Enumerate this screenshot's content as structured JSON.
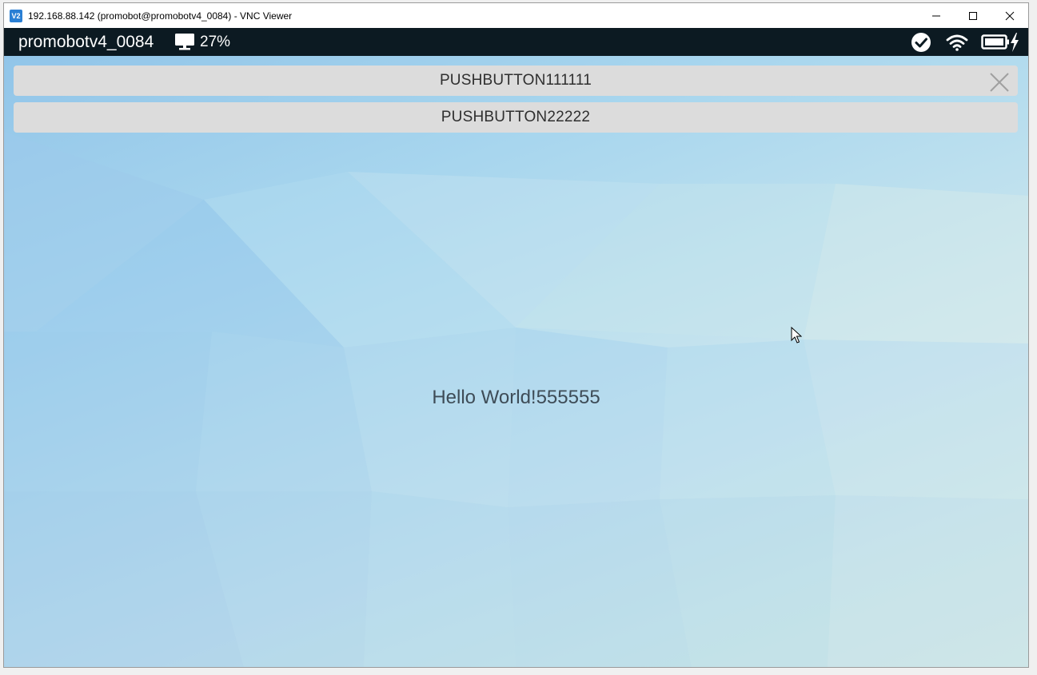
{
  "window": {
    "title": "192.168.88.142 (promobot@promobotv4_0084) - VNC Viewer",
    "icon": "vnc-viewer-icon",
    "controls": [
      "minimize-icon",
      "maximize-icon",
      "close-icon"
    ]
  },
  "statusbar": {
    "robot_name": "promobotv4_0084",
    "screen_icon": "monitor-icon",
    "screen_percent": "27%",
    "status_icons": [
      "check-circle-icon",
      "wifi-icon",
      "battery-charging-icon"
    ]
  },
  "buttons": {
    "button1_label": "PUSHBUTTON111111",
    "button2_label": "PUSHBUTTON22222"
  },
  "main": {
    "hello_text": "Hello World!555555"
  },
  "colors": {
    "statusbar_bg": "#0c1a22",
    "button_bg": "#dcdcdc",
    "text_dark": "#3e4c57"
  }
}
